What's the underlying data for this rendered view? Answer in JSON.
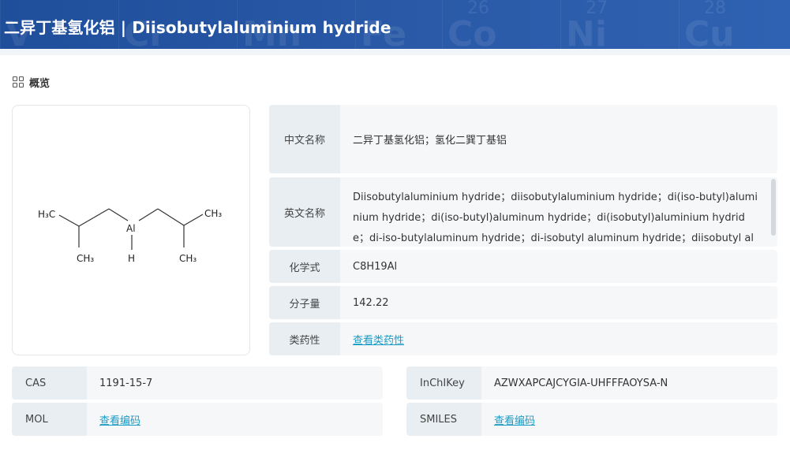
{
  "header": {
    "title": "二异丁基氢化铝 | Diisobutylaluminium hydride",
    "background_cells": [
      {
        "num": "",
        "sym": "V"
      },
      {
        "num": "",
        "sym": "Cr"
      },
      {
        "num": "",
        "sym": "Mn"
      },
      {
        "num": "",
        "sym": "Fe"
      },
      {
        "num": "26",
        "sym": "Co"
      },
      {
        "num": "27",
        "sym": "Ni"
      },
      {
        "num": "28",
        "sym": "Cu"
      }
    ]
  },
  "overview": {
    "section_label": "概览",
    "structure_labels": {
      "h3c": "H₃C",
      "ch3_right": "CH₃",
      "ch3_left_bottom": "CH₃",
      "ch3_right_bottom": "CH₃",
      "al": "Al",
      "h": "H"
    },
    "info": [
      {
        "key": "中文名称",
        "value": "二异丁基氢化铝；氢化二巽丁基铝"
      },
      {
        "key": "英文名称",
        "value": "Diisobutylaluminium hydride；diisobutylaluminium hydride；di(iso-butyl)aluminium hydride；di(iso-butyl)aluminum hydride；di(isobutyl)aluminium hydride；di-iso-butylaluminum hydride；di-isobutyl aluminum hydride；diisobutyl aluminium hydride"
      },
      {
        "key": "化学式",
        "value": "C8H19Al"
      },
      {
        "key": "分子量",
        "value": "142.22"
      },
      {
        "key": "类药性",
        "link": "查看类药性"
      }
    ]
  },
  "identifiers": {
    "cas": {
      "key": "CAS",
      "value": "1191-15-7"
    },
    "inchikey": {
      "key": "InChIKey",
      "value": "AZWXAPCAJCYGIA-UHFFFAOYSA-N"
    },
    "mol": {
      "key": "MOL",
      "link": "查看编码"
    },
    "smiles": {
      "key": "SMILES",
      "link": "查看编码"
    }
  },
  "colors": {
    "header_bg": "#2a5aa8",
    "link": "#1a9bc4",
    "key_bg": "#e9eef2",
    "row_bg": "#f5f7f9"
  }
}
